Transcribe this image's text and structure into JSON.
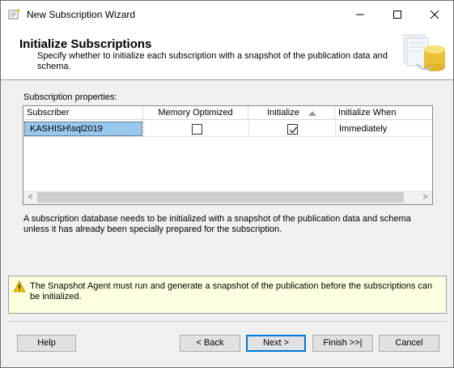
{
  "window": {
    "title": "New Subscription Wizard",
    "minimize_glyph": "—",
    "maximize_glyph": "☐",
    "close_glyph": "✕"
  },
  "header": {
    "title": "Initialize Subscriptions",
    "subtitle": "Specify whether to initialize each subscription with a snapshot of the publication data and schema."
  },
  "grid": {
    "label": "Subscription properties:",
    "columns": {
      "subscriber": "Subscriber",
      "memory_optimized": "Memory Optimized",
      "initialize": "Initialize",
      "initialize_when": "Initialize When"
    },
    "rows": [
      {
        "subscriber": "KASHISH\\sql2019",
        "memory_optimized": false,
        "initialize": true,
        "initialize_when": "Immediately"
      }
    ],
    "sort_column": "initialize",
    "scroll_left_glyph": "<",
    "scroll_right_glyph": ">"
  },
  "info_text": "A subscription database needs to be initialized with a snapshot of the publication data and schema unless it has already been specially prepared for the subscription.",
  "warning": {
    "icon": "warning-icon",
    "text": "The Snapshot Agent must run and generate a snapshot of the publication before the subscriptions can be initialized."
  },
  "buttons": {
    "help": "Help",
    "back": "< Back",
    "next": "Next >",
    "finish": "Finish >>|",
    "cancel": "Cancel"
  },
  "colors": {
    "selection": "#99c9ef",
    "warning_bg": "#ffffe1",
    "default_button_border": "#0078d7"
  }
}
